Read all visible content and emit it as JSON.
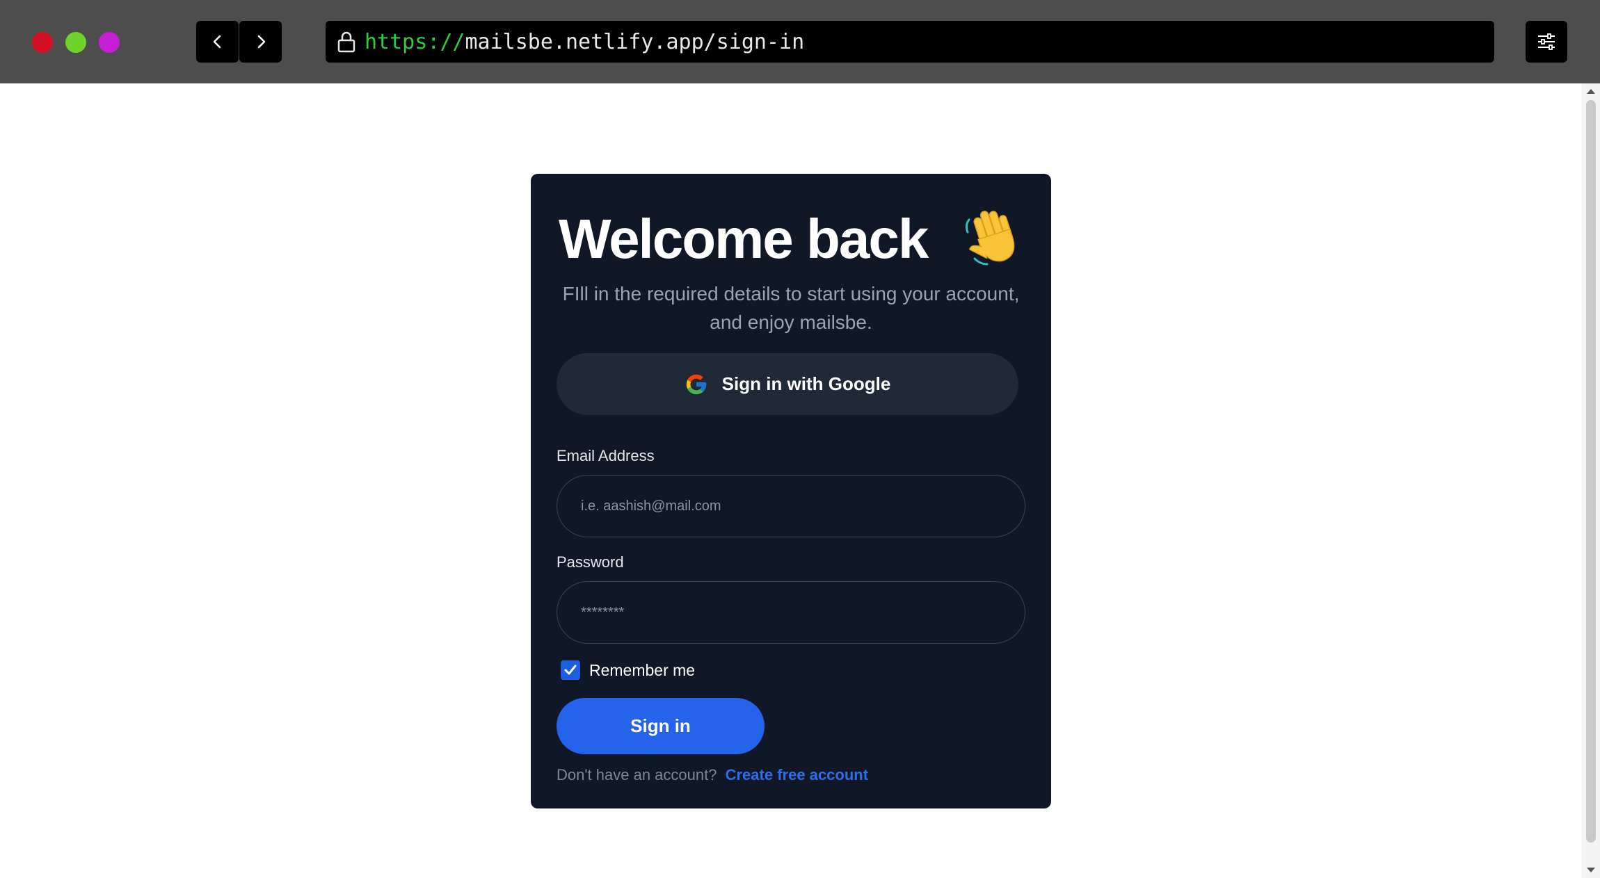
{
  "browser": {
    "url_scheme": "https://",
    "url_rest": "mailsbe.netlify.app/sign-in",
    "traffic_light_colors": [
      "#d40f23",
      "#6fd42a",
      "#c51ed4"
    ]
  },
  "signin": {
    "title": "Welcome back",
    "wave_emoji": "👋",
    "subtitle": "FIll in the required details to start using your account, and enjoy mailsbe.",
    "google_button_label": "Sign in with Google",
    "email": {
      "label": "Email Address",
      "placeholder": "i.e. aashish@mail.com",
      "value": ""
    },
    "password": {
      "label": "Password",
      "placeholder": "********",
      "value": ""
    },
    "remember_me": {
      "label": "Remember me",
      "checked": true
    },
    "submit_label": "Sign in",
    "footer": {
      "prompt": "Don't have an account?",
      "link_label": "Create free account"
    }
  },
  "colors": {
    "card_bg": "#101828",
    "primary": "#2563eb",
    "link": "#2f6ee8",
    "google_button_bg": "#1f2937"
  }
}
